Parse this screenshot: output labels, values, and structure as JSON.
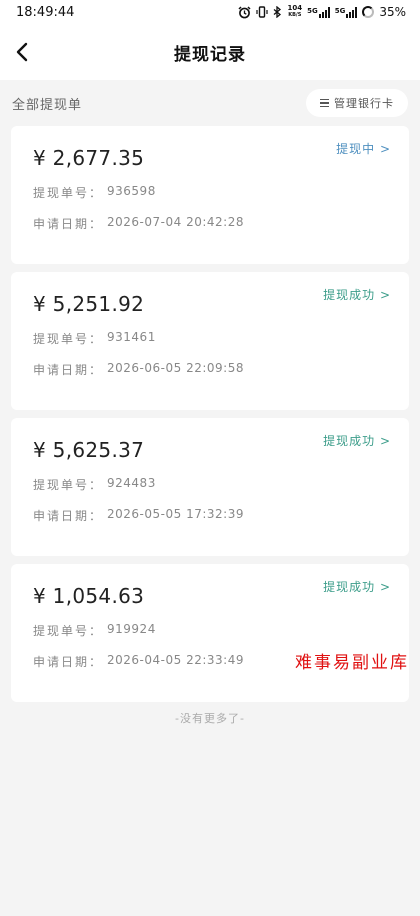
{
  "status_bar": {
    "time": "18:49:44",
    "net_speed_value": "104",
    "net_speed_unit": "KB/S",
    "sim1_label": "5G",
    "sim2_label": "5G",
    "battery": "35%"
  },
  "navbar": {
    "title": "提现记录"
  },
  "section": {
    "title": "全部提现单",
    "manage_label": "管理银行卡"
  },
  "labels": {
    "order_no": "提现单号：",
    "apply_date": "申请日期："
  },
  "records": [
    {
      "amount": "¥ 2,677.35",
      "status": "提现中 >",
      "order_no": "936598",
      "date": "2026-07-04 20:42:28"
    },
    {
      "amount": "¥ 5,251.92",
      "status": "提现成功 >",
      "order_no": "931461",
      "date": "2026-06-05 22:09:58"
    },
    {
      "amount": "¥ 5,625.37",
      "status": "提现成功 >",
      "order_no": "924483",
      "date": "2026-05-05 17:32:39"
    },
    {
      "amount": "¥ 1,054.63",
      "status": "提现成功 >",
      "order_no": "919924",
      "date": "2026-04-05 22:33:49"
    }
  ],
  "watermark": "难事易副业库",
  "footer": {
    "no_more": "-没有更多了-"
  },
  "colors": {
    "pending": "#4e8fbf",
    "success": "#3c9d8a",
    "watermark": "#e01010"
  }
}
